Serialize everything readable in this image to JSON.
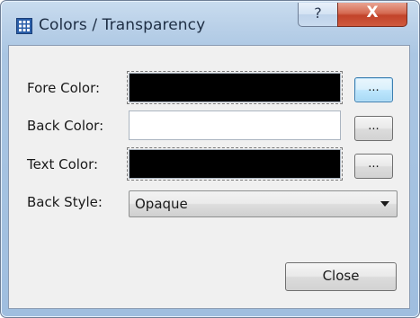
{
  "window": {
    "title": "Colors / Transparency",
    "help_glyph": "?",
    "close_glyph": "X",
    "icon": "grid-app-icon"
  },
  "form": {
    "fore_color": {
      "label": "Fore Color:",
      "value_color": "#000000",
      "button_label": "..."
    },
    "back_color": {
      "label": "Back Color:",
      "value_color": "#ffffff",
      "button_label": "..."
    },
    "text_color": {
      "label": "Text Color:",
      "value_color": "#000000",
      "button_label": "..."
    },
    "back_style": {
      "label": "Back Style:",
      "selected": "Opaque"
    }
  },
  "footer": {
    "close_label": "Close"
  }
}
